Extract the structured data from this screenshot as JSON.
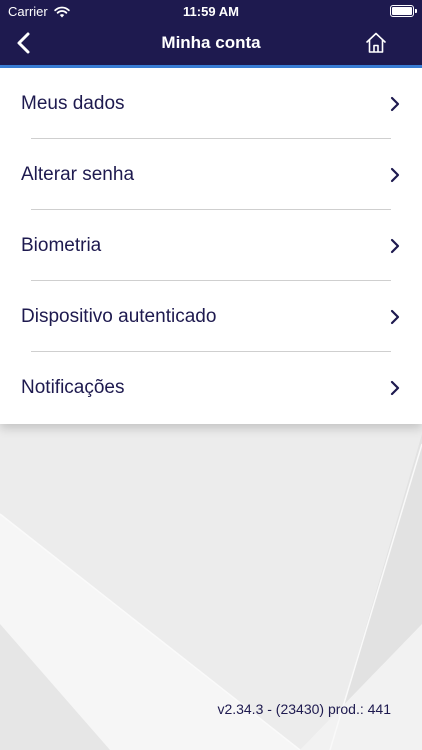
{
  "status_bar": {
    "carrier": "Carrier",
    "time": "11:59 AM",
    "wifi_icon": "wifi-icon",
    "battery_icon": "battery-full-icon"
  },
  "nav": {
    "title": "Minha conta",
    "back_icon": "chevron-left-icon",
    "home_icon": "home-icon"
  },
  "menu": {
    "items": [
      {
        "label": "Meus dados"
      },
      {
        "label": "Alterar senha"
      },
      {
        "label": "Biometria"
      },
      {
        "label": "Dispositivo autenticado"
      },
      {
        "label": "Notificações"
      }
    ],
    "chevron_icon": "chevron-right-icon"
  },
  "footer": {
    "version": "v2.34.3 - (23430) prod.: 441"
  },
  "colors": {
    "nav_background": "#1e1a4f",
    "accent": "#3a7fd8",
    "text": "#1e1a4f",
    "background": "#ededed"
  }
}
